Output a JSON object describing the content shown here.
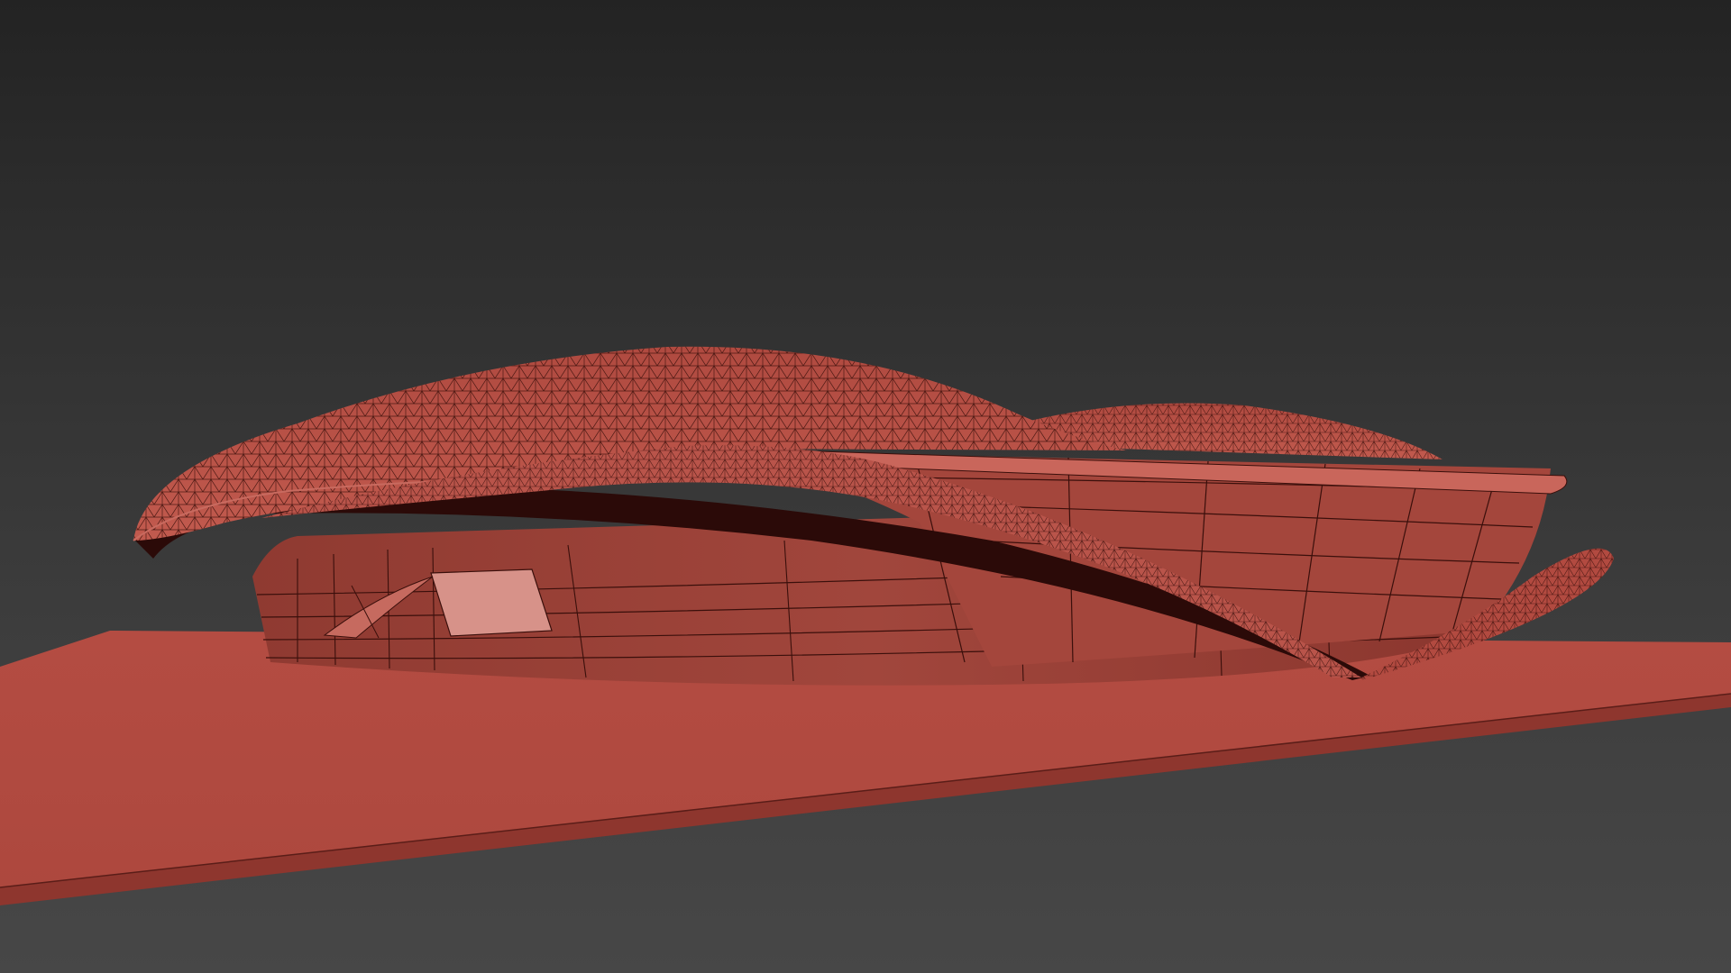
{
  "viewport": {
    "background_top": "#232323",
    "background_bottom": "#474747",
    "shading": "wireframe-on-shaded"
  },
  "model": {
    "base_color": "#c45549",
    "shell_color": "#b24a40",
    "shadow_color": "#2b0a08",
    "glass_color": "#9e3f35",
    "wire_color": "#3a0f0b",
    "highlight_color": "#e9a29a"
  }
}
